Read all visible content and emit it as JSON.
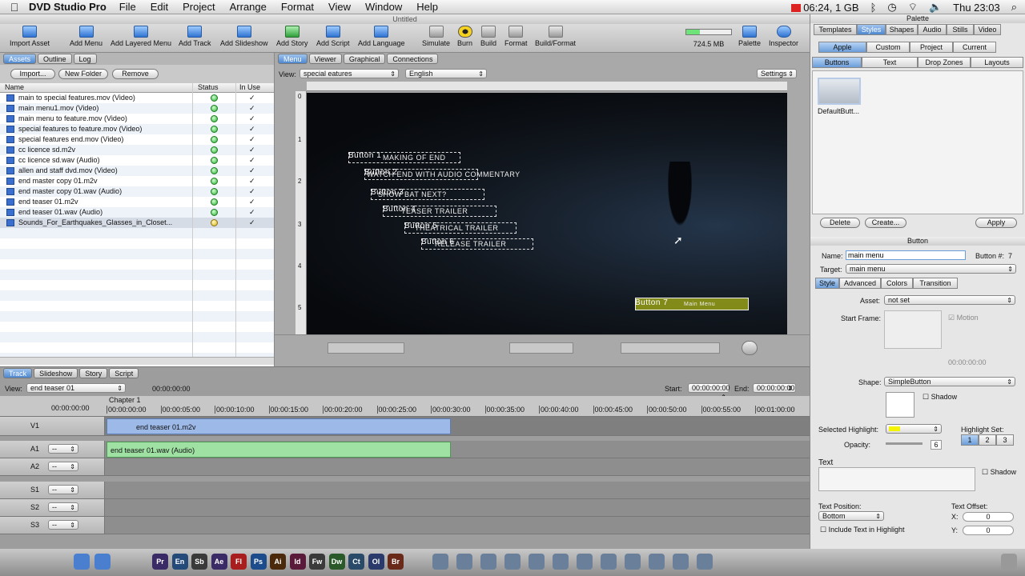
{
  "menubar": {
    "app": "DVD Studio Pro",
    "items": [
      "File",
      "Edit",
      "Project",
      "Arrange",
      "Format",
      "View",
      "Window",
      "Help"
    ],
    "battery": "06:24, 1 GB",
    "clock": "Thu 23:03"
  },
  "window": {
    "title": "Untitled"
  },
  "toolbar": {
    "items": [
      "Import Asset",
      "Add Menu",
      "Add Layered Menu",
      "Add Track",
      "Add Slideshow",
      "Add Story",
      "Add Script",
      "Add Language",
      "Simulate",
      "Burn",
      "Build",
      "Format",
      "Build/Format"
    ],
    "disk": "724.5 MB",
    "palette": "Palette",
    "inspector": "Inspector"
  },
  "assets": {
    "tabs": [
      "Assets",
      "Outline",
      "Log"
    ],
    "buttons": [
      "Import...",
      "New Folder",
      "Remove"
    ],
    "columns": [
      "Name",
      "Status",
      "In Use"
    ],
    "rows": [
      "main to special features.mov (Video)",
      "main menu1.mov (Video)",
      "main menu to feature.mov (Video)",
      "special features to feature.mov (Video)",
      "special features end.mov (Video)",
      "cc licence sd.m2v",
      "cc licence sd.wav (Audio)",
      "allen and staff dvd.mov (Video)",
      "end master copy 01.m2v",
      "end master copy 01.wav (Audio)",
      "end teaser 01.m2v",
      "end teaser 01.wav (Audio)",
      "Sounds_For_Earthquakes_Glasses_in_Closet..."
    ],
    "checks": "✓"
  },
  "viewer": {
    "tabs": [
      "Menu",
      "Viewer",
      "Graphical",
      "Connections"
    ],
    "view_label": "View:",
    "view_value": "special eatures",
    "lang": "English",
    "settings": "Settings",
    "buttons": [
      {
        "label": "Button 1",
        "text": "MAKING OF END"
      },
      {
        "label": "Button 2",
        "text": "WATCH END WITH AUDIO COMMENTARY"
      },
      {
        "label": "Button 3",
        "text": "SHOW BAT NEXT?"
      },
      {
        "label": "Button 4",
        "text": "TEASER TRAILER"
      },
      {
        "label": "Button 5",
        "text": "THEATRICAL TRAILER"
      },
      {
        "label": "Button 6",
        "text": "RELEASE TRAILER"
      },
      {
        "label": "Button 7",
        "text": "Main Menu"
      }
    ],
    "ruler": [
      "0",
      "1",
      "2",
      "3",
      "4",
      "5"
    ]
  },
  "timeline": {
    "tabs": [
      "Track",
      "Slideshow",
      "Story",
      "Script"
    ],
    "view_label": "View:",
    "view_value": "end teaser 01",
    "timecode": "00:00:00:00",
    "start_label": "Start:",
    "start": "00:00:00:00",
    "end_label": "End:",
    "end": "00:00:00:00",
    "current": "00:00:00:00",
    "chapter": "Chapter 1",
    "ticks": [
      "00:00:00:00",
      "00:00:05:00",
      "00:00:10:00",
      "00:00:15:00",
      "00:00:20:00",
      "00:00:25:00",
      "00:00:30:00",
      "00:00:35:00",
      "00:00:40:00",
      "00:00:45:00",
      "00:00:50:00",
      "00:00:55:00",
      "00:01:00:00"
    ],
    "tracks": [
      "V1",
      "A1",
      "A2",
      "S1",
      "S2",
      "S3"
    ],
    "clip_v": "end teaser 01.m2v",
    "clip_a": "end teaser 01.wav (Audio)",
    "dash": "--"
  },
  "palette": {
    "title": "Palette",
    "tabs": [
      "Templates",
      "Styles",
      "Shapes",
      "Audio",
      "Stills",
      "Video"
    ],
    "scope": [
      "Apple",
      "Custom",
      "Project",
      "Current"
    ],
    "kinds": [
      "Buttons",
      "Text",
      "Drop Zones",
      "Layouts"
    ],
    "thumb": "DefaultButt...",
    "delete": "Delete",
    "create": "Create...",
    "apply": "Apply"
  },
  "inspector": {
    "title": "Button",
    "name_label": "Name:",
    "name": "main menu",
    "num_label": "Button #:",
    "num": "7",
    "target_label": "Target:",
    "target": "main menu",
    "tabs": [
      "Style",
      "Advanced",
      "Colors",
      "Transition"
    ],
    "asset_label": "Asset:",
    "asset": "not set",
    "start_frame": "Start Frame:",
    "motion": "Motion",
    "tc": "00:00:00:00",
    "shape_label": "Shape:",
    "shape": "SimpleButton",
    "shadow": "Shadow",
    "sel_hl": "Selected Highlight:",
    "opacity": "Opacity:",
    "opacity_val": "6",
    "hl_set": "Highlight Set:",
    "hl_nums": [
      "1",
      "2",
      "3"
    ],
    "text": "Text",
    "text_pos_label": "Text Position:",
    "text_pos": "Bottom",
    "text_offset": "Text Offset:",
    "x_label": "X:",
    "x": "0",
    "y_label": "Y:",
    "y": "0",
    "include": "Include Text in Highlight",
    "hl_color": "#f4f400"
  },
  "dock": [
    "Pr",
    "En",
    "Sb",
    "Ae",
    "Fl",
    "Ps",
    "Ai",
    "Id",
    "Fw",
    "Dw",
    "Ct",
    "Ol",
    "Br"
  ]
}
